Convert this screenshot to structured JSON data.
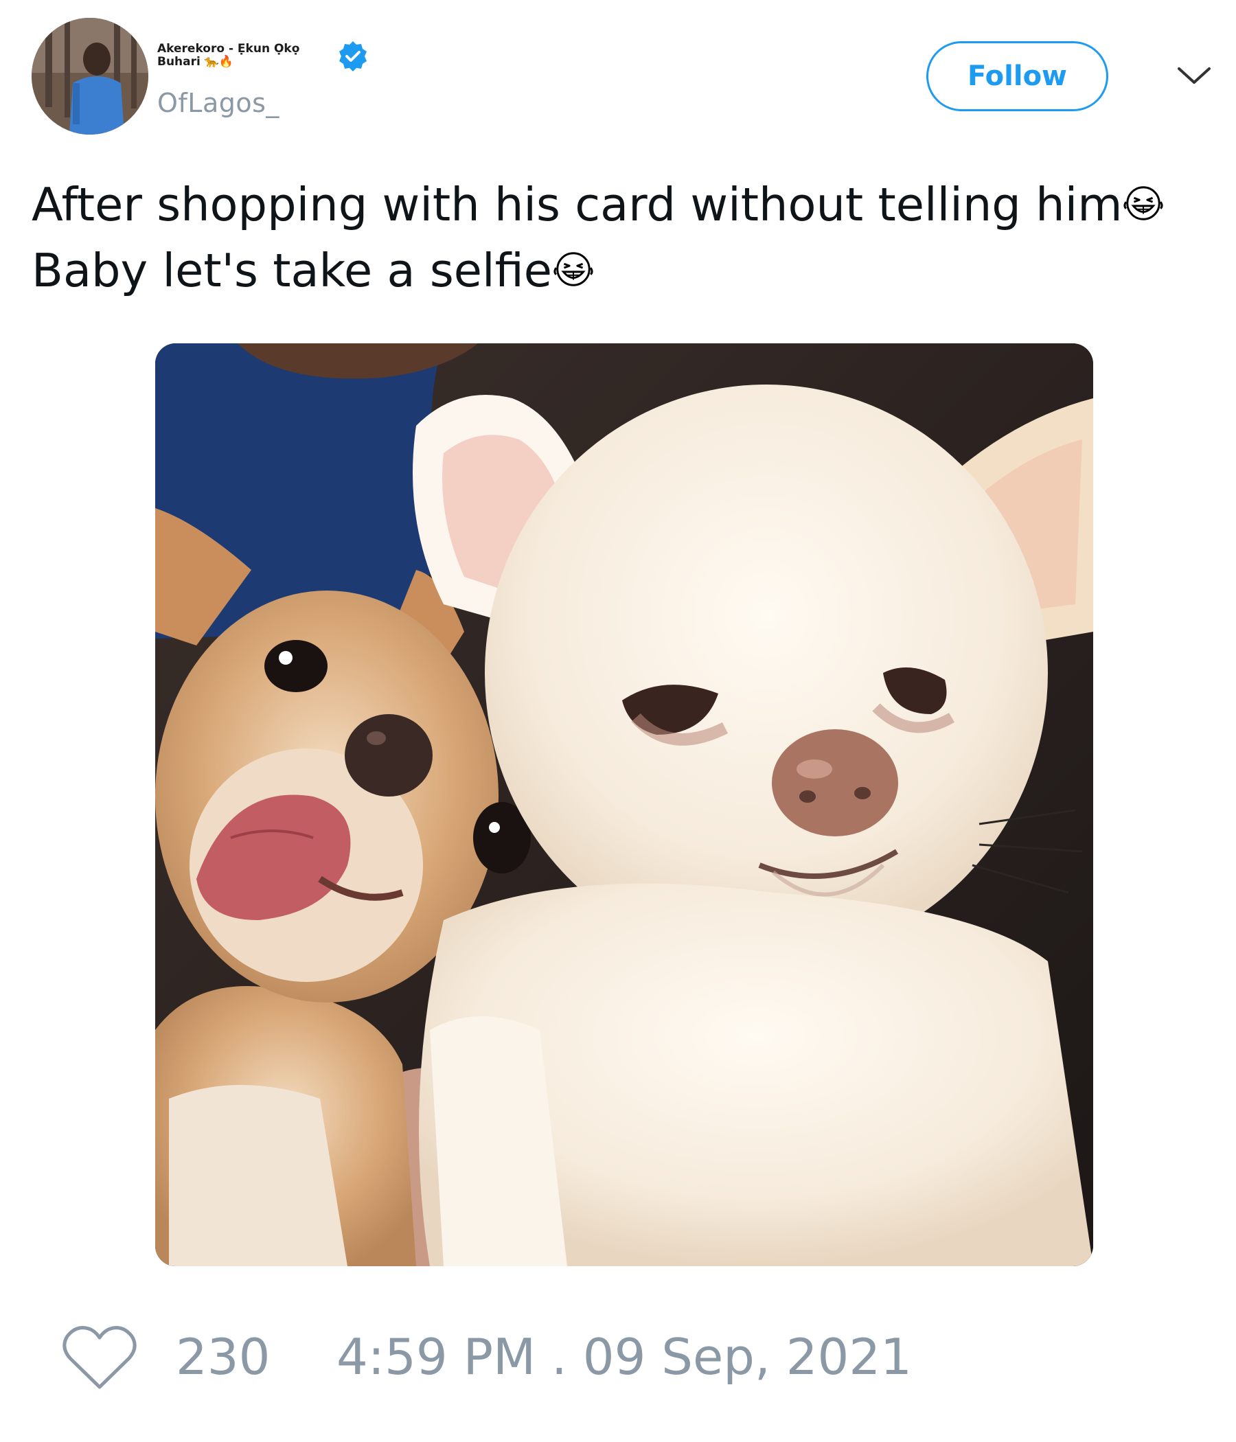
{
  "tweet": {
    "author": {
      "display_name": "Akerekoro - Ẹkun Ọkọ Buhari 🐆🔥",
      "handle": "OfLagos_",
      "verified": true,
      "avatar_icon": "profile-photo"
    },
    "follow_label": "Follow",
    "text_lines": [
      "After shopping with his card without telling him",
      "Baby let's take a selfie"
    ],
    "text_emoji": "grinning-squinting-face",
    "media": {
      "type": "photo",
      "subject": "two chihuahuas selfie"
    },
    "likes": "230",
    "timestamp": "4:59 PM . 09 Sep, 2021"
  },
  "icons": {
    "verified": "verified-badge-icon",
    "more": "chevron-down-icon",
    "like": "heart-outline-icon"
  },
  "colors": {
    "accent": "#1d9bf0",
    "muted_text": "#8b98a5",
    "text": "#0f1419"
  }
}
